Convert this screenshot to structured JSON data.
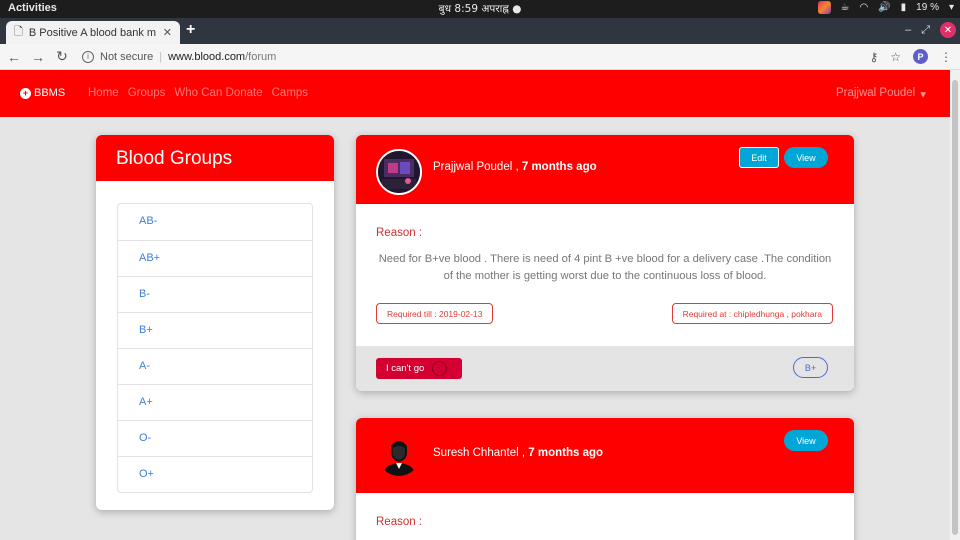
{
  "os": {
    "activities": "Activities",
    "clock": "बुध   8:59 अपराह्न ●",
    "battery": "19 %"
  },
  "browser": {
    "tab_title": "B Positive A blood bank m",
    "new_tab": "+",
    "security": "Not secure",
    "url_host": "www.blood.com",
    "url_path": "/forum",
    "profile_initial": "P"
  },
  "nav": {
    "brand": "BBMS",
    "links": [
      "Home",
      "Groups",
      "Who Can Donate",
      "Camps"
    ],
    "user": "Prajjwal Poudel",
    "accent_color": "#ff0000"
  },
  "sidebar": {
    "title": "Blood Groups",
    "groups": [
      "AB-",
      "AB+",
      "B-",
      "B+",
      "A-",
      "A+",
      "O-",
      "O+"
    ]
  },
  "posts": [
    {
      "author": "Prajjwal Poudel ,",
      "time": "7 months ago",
      "edit_label": "Edit",
      "view_label": "View",
      "reason_label": "Reason :",
      "reason": "Need for B+ve blood . There is need of 4 pint B +ve blood for a delivery case .The condition of the mother is getting worst due to the continuous loss of blood.",
      "required_till": "Required till : 2019-02-13",
      "required_at": "Required at : chipledhunga , pokhara",
      "cant_go_label": "I can't go",
      "blood_group": "B+"
    },
    {
      "author": "Suresh Chhantel ,",
      "time": "7 months ago",
      "view_label": "View",
      "reason_label": "Reason :"
    }
  ]
}
